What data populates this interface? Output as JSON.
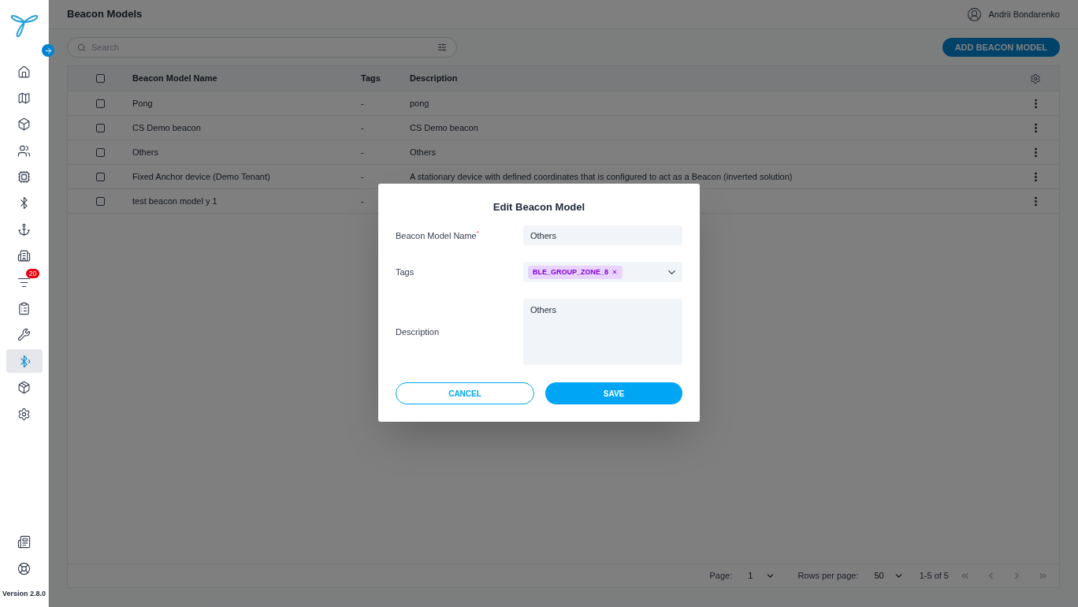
{
  "page_title": "Beacon Models",
  "user": {
    "name": "Andrii Bondarenko"
  },
  "sidebar": {
    "items": [
      {
        "selected": false
      },
      {
        "selected": false
      },
      {
        "selected": false
      },
      {
        "selected": false
      },
      {
        "selected": false
      },
      {
        "selected": false
      },
      {
        "selected": false
      },
      {
        "selected": false
      },
      {
        "selected": false,
        "badge": "20"
      },
      {
        "selected": false
      },
      {
        "selected": false
      },
      {
        "selected": true
      },
      {
        "selected": false
      },
      {
        "selected": false
      }
    ],
    "bottom_items": [
      {
        "selected": false
      },
      {
        "selected": false
      }
    ],
    "version": "Version 2.8.0"
  },
  "search": {
    "placeholder": "Search"
  },
  "add_button": "ADD BEACON MODEL",
  "table": {
    "columns": [
      "Beacon Model Name",
      "Tags",
      "Description"
    ],
    "rows": [
      {
        "checked": false,
        "cells": [
          "Pong",
          "-",
          "pong"
        ]
      },
      {
        "checked": false,
        "cells": [
          "CS Demo beacon",
          "-",
          "CS Demo beacon"
        ]
      },
      {
        "checked": false,
        "cells": [
          "Others",
          "-",
          "Others"
        ]
      },
      {
        "checked": false,
        "cells": [
          "Fixed Anchor device (Demo Tenant)",
          "-",
          "A stationary device with defined coordinates that is configured to act as a Beacon (inverted solution)"
        ]
      },
      {
        "checked": false,
        "cells": [
          "test beacon model y 1",
          "-",
          ""
        ]
      }
    ],
    "header_checked": false
  },
  "pagination": {
    "page_label": "Page:",
    "page": "1",
    "rows_label": "Rows per page:",
    "rows": "50",
    "range": "1-5 of 5"
  },
  "dialog": {
    "title": "Edit Beacon Model",
    "name_label": "Beacon Model Name",
    "name_required_mark": "*",
    "name_value": "Others",
    "tags_label": "Tags",
    "tags": [
      "BLE_GROUP_ZONE_8"
    ],
    "description_label": "Description",
    "description_value": "Others",
    "cancel": "CANCEL",
    "save": "SAVE"
  }
}
